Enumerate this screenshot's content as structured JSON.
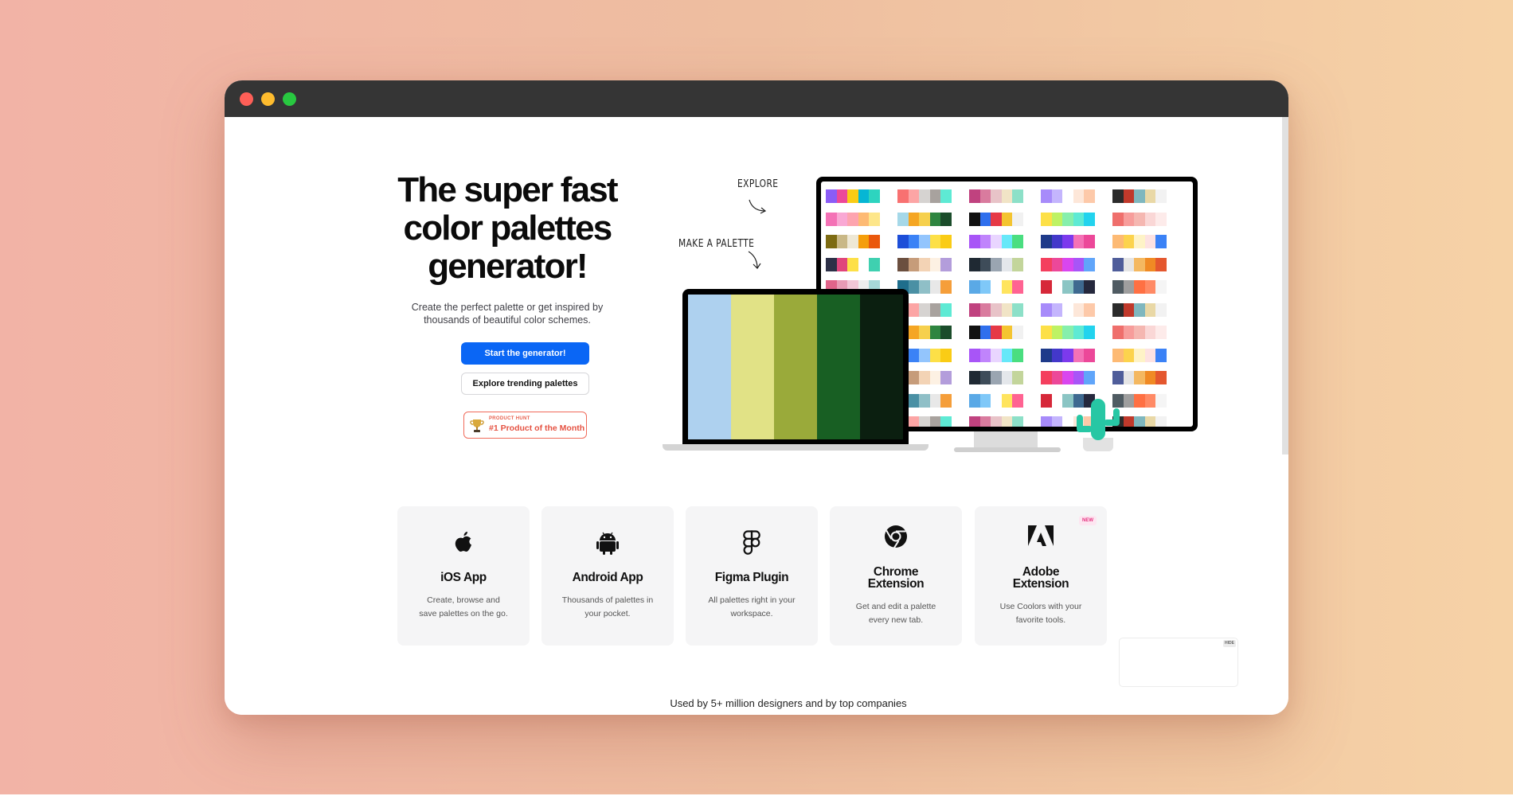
{
  "window": {
    "controls": [
      "close",
      "minimize",
      "maximize"
    ]
  },
  "hero": {
    "title_line1": "The super fast",
    "title_line2": "color palettes",
    "title_line3": "generator!",
    "subtitle_line1": "Create the perfect palette or get inspired by",
    "subtitle_line2": "thousands of beautiful color schemes.",
    "primary_button": "Start the generator!",
    "secondary_button": "Explore trending palettes",
    "badge_small": "PRODUCT HUNT",
    "badge_text": "#1 Product of the Month"
  },
  "illustration": {
    "explore_label": "EXPLORE",
    "make_label": "MAKE A PALETTE",
    "laptop_palette": [
      "#aed1ef",
      "#e1e286",
      "#9aaa3a",
      "#185f23",
      "#0b1f10"
    ],
    "monitor_palettes": [
      [
        "#8b5cf6",
        "#ec4899",
        "#facc15",
        "#06b6d4",
        "#2dd4bf"
      ],
      [
        "#f87171",
        "#fca5a5",
        "#d6d3d1",
        "#a8a29e",
        "#5eead4"
      ],
      [
        "#c0427f",
        "#d97b9e",
        "#e8c3c8",
        "#f1e4c6",
        "#8de0c8"
      ],
      [
        "#a78bfa",
        "#c4b5fd",
        "#ffffff",
        "#fde7d9",
        "#fdc9a9"
      ],
      [
        "#2b2b2b",
        "#c0392b",
        "#7fb7be",
        "#e9d8a6",
        "#f2f2f2"
      ],
      [
        "#f472b6",
        "#f9a8d4",
        "#fda4af",
        "#fdba74",
        "#fde68a"
      ],
      [
        "#a5d8e8",
        "#f5a623",
        "#f6d04d",
        "#2e8540",
        "#1b4d2b"
      ],
      [
        "#111111",
        "#2f6fed",
        "#e63946",
        "#f4c430",
        "#f1f1f1"
      ],
      [
        "#fde047",
        "#bef264",
        "#86efac",
        "#5eead4",
        "#22d3ee"
      ],
      [
        "#ef6f6c",
        "#f79d9b",
        "#f5b7b1",
        "#fad7d6",
        "#fdebea"
      ],
      [
        "#7d6b12",
        "#c9b886",
        "#eee8d5",
        "#f59e0b",
        "#ea580c"
      ],
      [
        "#1d4ed8",
        "#3b82f6",
        "#93c5fd",
        "#fde047",
        "#facc15"
      ],
      [
        "#a855f7",
        "#c084fc",
        "#e9d5ff",
        "#67e8f9",
        "#4ade80"
      ],
      [
        "#1e3a8a",
        "#4338ca",
        "#7c3aed",
        "#f472b6",
        "#ec4899"
      ],
      [
        "#fdba74",
        "#fcd34d",
        "#fef3c7",
        "#fde2e2",
        "#3b82f6"
      ],
      [
        "#2d3047",
        "#e0457b",
        "#fde047",
        "#ffffff",
        "#3fd0b0"
      ],
      [
        "#6b4f3f",
        "#c69c7a",
        "#f3d3b5",
        "#fdf1e3",
        "#b39ddb"
      ],
      [
        "#1f2933",
        "#3e4c59",
        "#9aa5b1",
        "#e4e7eb",
        "#c3d59b"
      ],
      [
        "#f43f5e",
        "#ec4899",
        "#d946ef",
        "#a855f7",
        "#60a5fa"
      ],
      [
        "#4f5d9a",
        "#e5e5e5",
        "#f4b860",
        "#f08a24",
        "#e4572e"
      ],
      [
        "#e0648a",
        "#e89bb5",
        "#f2c6d6",
        "#eeeeee",
        "#a7d8d8"
      ],
      [
        "#1f6e8c",
        "#4a90a4",
        "#8fbfc7",
        "#e8e8e8",
        "#f59e3a"
      ],
      [
        "#5aa9e6",
        "#7fc8f8",
        "#ffffff",
        "#ffe45e",
        "#ff6392"
      ],
      [
        "#d62839",
        "#ffffff",
        "#8bc5c4",
        "#3e6990",
        "#25283d"
      ],
      [
        "#4f5b62",
        "#9e9e9e",
        "#ff7043",
        "#ff8a65",
        "#f5f5f5"
      ]
    ]
  },
  "cards": [
    {
      "title": "iOS App",
      "desc_line1": "Create, browse and",
      "desc_line2": "save palettes on the go.",
      "icon": "apple-icon"
    },
    {
      "title": "Android App",
      "desc_line1": "Thousands of palettes in",
      "desc_line2": "your pocket.",
      "icon": "android-icon"
    },
    {
      "title": "Figma Plugin",
      "desc_line1": "All palettes right in your",
      "desc_line2": "workspace.",
      "icon": "figma-icon"
    },
    {
      "title_line1": "Chrome",
      "title_line2": "Extension",
      "desc_line1": "Get and edit a palette",
      "desc_line2": "every new tab.",
      "icon": "chrome-icon"
    },
    {
      "title_line1": "Adobe",
      "title_line2": "Extension",
      "desc_line1": "Use Coolors with your",
      "desc_line2": "favorite tools.",
      "icon": "adobe-icon",
      "badge": "NEW"
    }
  ],
  "ad": {
    "hide_label": "HIDE"
  },
  "footer": {
    "text": "Used by 5+ million designers and by top companies"
  },
  "colors": {
    "primary": "#0a66f5",
    "badge": "#e55242",
    "new_badge": "#e5307f"
  }
}
